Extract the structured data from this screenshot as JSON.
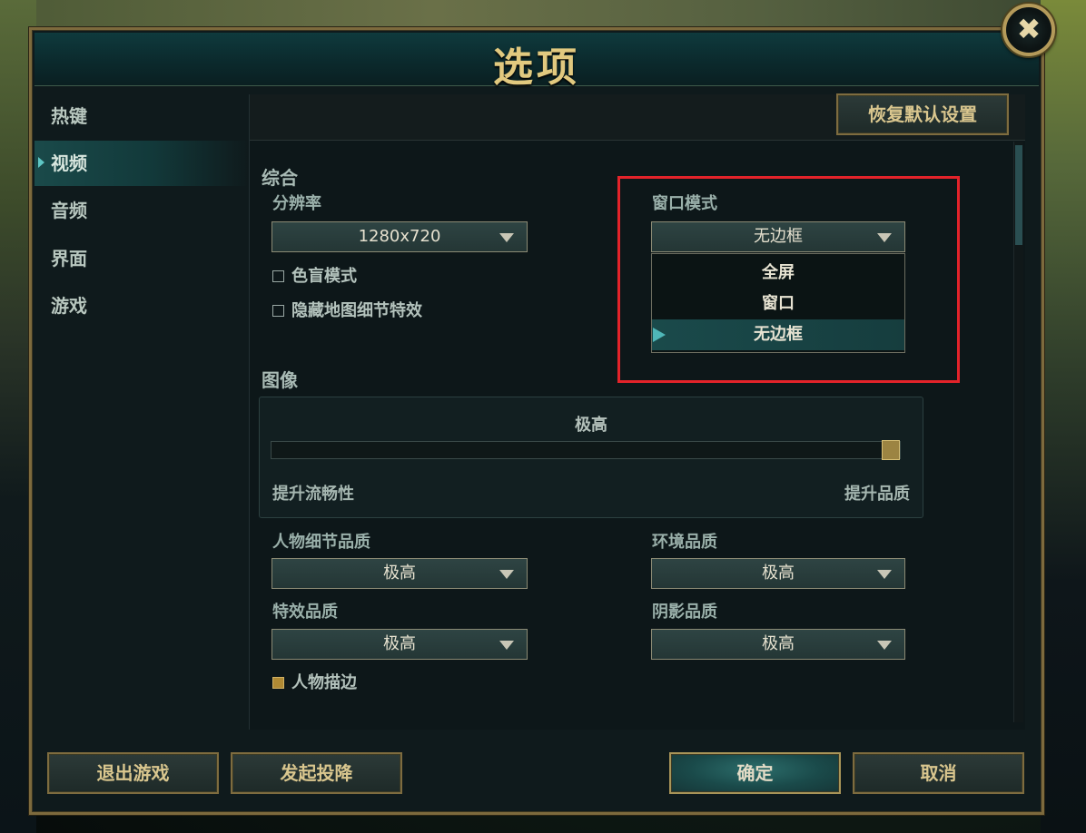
{
  "window": {
    "title": "选项",
    "close_label": "✖"
  },
  "sidebar": {
    "items": [
      {
        "label": "热键",
        "active": false
      },
      {
        "label": "视频",
        "active": true
      },
      {
        "label": "音频",
        "active": false
      },
      {
        "label": "界面",
        "active": false
      },
      {
        "label": "游戏",
        "active": false
      }
    ]
  },
  "toolbar": {
    "reset_label": "恢复默认设置"
  },
  "general": {
    "section_label": "综合",
    "resolution": {
      "label": "分辨率",
      "value": "1280x720"
    },
    "colorblind": {
      "label": "色盲模式",
      "checked": false
    },
    "hide_eyecandy": {
      "label": "隐藏地图细节特效",
      "checked": false
    },
    "window_mode": {
      "label": "窗口模式",
      "value": "无边框",
      "options": [
        "全屏",
        "窗口",
        "无边框"
      ],
      "selected_index": 2
    }
  },
  "graphics": {
    "section_label": "图像",
    "preset_value": "极高",
    "slider_level": 1.0,
    "left_label": "提升流畅性",
    "right_label": "提升品质",
    "character_quality": {
      "label": "人物细节品质",
      "value": "极高"
    },
    "environment_quality": {
      "label": "环境品质",
      "value": "极高"
    },
    "effects_quality": {
      "label": "特效品质",
      "value": "极高"
    },
    "shadow_quality": {
      "label": "阴影品质",
      "value": "极高"
    },
    "character_outline": {
      "label": "人物描边",
      "checked": true
    }
  },
  "footer": {
    "exit_label": "退出游戏",
    "surrender_label": "发起投降",
    "confirm_label": "确定",
    "cancel_label": "取消"
  },
  "colors": {
    "accent_gold": "#7d6a3d",
    "teal_active": "#1a4a4a",
    "highlight_red": "#e3232a"
  }
}
